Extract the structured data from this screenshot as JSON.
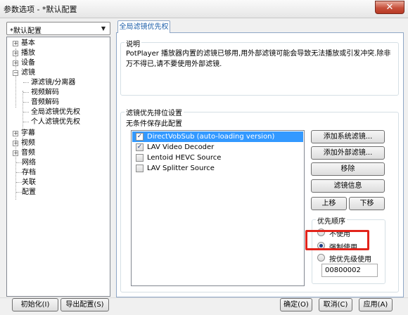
{
  "window": {
    "title": "参数选项 - *默认配置",
    "close_symbol": "✕"
  },
  "preset": {
    "value": "*默认配置",
    "arrow": "▼"
  },
  "tree": {
    "expand_symbol": "+",
    "collapse_symbol": "−",
    "items": [
      {
        "label": "基本"
      },
      {
        "label": "播放"
      },
      {
        "label": "设备"
      },
      {
        "label": "滤镜"
      },
      {
        "label": "源滤镜/分离器"
      },
      {
        "label": "视频解码"
      },
      {
        "label": "音频解码"
      },
      {
        "label": "全局滤镜优先权"
      },
      {
        "label": "个人滤镜优先权"
      },
      {
        "label": "字幕"
      },
      {
        "label": "视频"
      },
      {
        "label": "音频"
      },
      {
        "label": "网络"
      },
      {
        "label": "存档"
      },
      {
        "label": "关联"
      },
      {
        "label": "配置"
      }
    ]
  },
  "tab": {
    "label": "全局滤镜优先权"
  },
  "description": {
    "title": "说明",
    "text": "PotPlayer 播放器内置的滤镜已够用,用外部滤镜可能会导致无法播放或引发冲突.除非万不得已,请不要使用外部滤镜."
  },
  "filters": {
    "title": "滤镜优先排位设置",
    "sublabel": "无条件保存此配置",
    "items": [
      {
        "name": "DirectVobSub (auto-loading version)",
        "checked": true,
        "selected": true
      },
      {
        "name": "LAV Video Decoder",
        "checked": true,
        "selected": false
      },
      {
        "name": "Lentoid HEVC Source",
        "checked": false,
        "selected": false
      },
      {
        "name": "LAV Splitter Source",
        "checked": false,
        "selected": false
      }
    ],
    "check_symbol": "✓",
    "buttons": {
      "add_system": "添加系统滤镜...",
      "add_external": "添加外部滤镜...",
      "remove": "移除",
      "info": "滤镜信息",
      "move_up": "上移",
      "move_down": "下移"
    }
  },
  "priority": {
    "title": "优先顺序",
    "options": [
      {
        "label": "不使用",
        "checked": false
      },
      {
        "label": "强制使用",
        "checked": true
      },
      {
        "label": "按优先级使用",
        "checked": false
      }
    ],
    "value": "00800002",
    "highlight_color": "#e2241b"
  },
  "footer": {
    "init": "初始化(I)",
    "export": "导出配置(S)",
    "ok": "确定(O)",
    "cancel": "取消(C)",
    "apply": "应用(A)"
  },
  "colors": {
    "selection": "#3399ff",
    "tab_text": "#1c5eaa",
    "close_button": "#c7503b"
  }
}
